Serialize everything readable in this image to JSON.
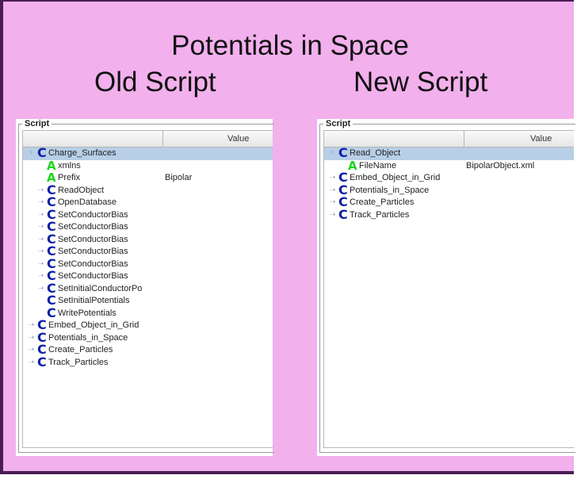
{
  "slide": {
    "title": "Potentials in Space",
    "left_heading": "Old Script",
    "right_heading": "New Script"
  },
  "left_panel": {
    "group_label": "Script",
    "value_header": "Value",
    "rows": [
      {
        "label": "Charge_Surfaces",
        "icon": "C",
        "handle": "expanded",
        "indent": 0,
        "selected": true,
        "value": ""
      },
      {
        "label": "xmlns",
        "icon": "A",
        "handle": "none",
        "indent": 1,
        "value": ""
      },
      {
        "label": "Prefix",
        "icon": "A",
        "handle": "none",
        "indent": 1,
        "value": "Bipolar"
      },
      {
        "label": "ReadObject",
        "icon": "C",
        "handle": "collapsed",
        "indent": 1,
        "value": ""
      },
      {
        "label": "OpenDatabase",
        "icon": "C",
        "handle": "collapsed",
        "indent": 1,
        "value": ""
      },
      {
        "label": "SetConductorBias",
        "icon": "C",
        "handle": "collapsed",
        "indent": 1,
        "value": ""
      },
      {
        "label": "SetConductorBias",
        "icon": "C",
        "handle": "collapsed",
        "indent": 1,
        "value": ""
      },
      {
        "label": "SetConductorBias",
        "icon": "C",
        "handle": "collapsed",
        "indent": 1,
        "value": ""
      },
      {
        "label": "SetConductorBias",
        "icon": "C",
        "handle": "collapsed",
        "indent": 1,
        "value": ""
      },
      {
        "label": "SetConductorBias",
        "icon": "C",
        "handle": "collapsed",
        "indent": 1,
        "value": ""
      },
      {
        "label": "SetConductorBias",
        "icon": "C",
        "handle": "collapsed",
        "indent": 1,
        "value": ""
      },
      {
        "label": "SetInitialConductorPo",
        "icon": "C",
        "handle": "collapsed",
        "indent": 1,
        "value": ""
      },
      {
        "label": "SetInitialPotentials",
        "icon": "C",
        "handle": "none",
        "indent": 1,
        "value": ""
      },
      {
        "label": "WritePotentials",
        "icon": "C",
        "handle": "none",
        "indent": 1,
        "value": ""
      },
      {
        "label": "Embed_Object_in_Grid",
        "icon": "C",
        "handle": "collapsed",
        "indent": 0,
        "value": ""
      },
      {
        "label": "Potentials_in_Space",
        "icon": "C",
        "handle": "collapsed",
        "indent": 0,
        "value": ""
      },
      {
        "label": "Create_Particles",
        "icon": "C",
        "handle": "collapsed",
        "indent": 0,
        "value": ""
      },
      {
        "label": "Track_Particles",
        "icon": "C",
        "handle": "collapsed",
        "indent": 0,
        "value": ""
      }
    ]
  },
  "right_panel": {
    "group_label": "Script",
    "value_header": "Value",
    "rows": [
      {
        "label": "Read_Object",
        "icon": "C",
        "handle": "expanded",
        "indent": 0,
        "selected": true,
        "value": ""
      },
      {
        "label": "FileName",
        "icon": "A",
        "handle": "none",
        "indent": 1,
        "value": "BipolarObject.xml"
      },
      {
        "label": "Embed_Object_in_Grid",
        "icon": "C",
        "handle": "collapsed",
        "indent": 0,
        "value": ""
      },
      {
        "label": "Potentials_in_Space",
        "icon": "C",
        "handle": "collapsed",
        "indent": 0,
        "value": ""
      },
      {
        "label": "Create_Particles",
        "icon": "C",
        "handle": "collapsed",
        "indent": 0,
        "value": ""
      },
      {
        "label": "Track_Particles",
        "icon": "C",
        "handle": "collapsed",
        "indent": 0,
        "value": ""
      }
    ]
  },
  "icons": {
    "expanded_handle": "handle-expanded-icon",
    "collapsed_handle": "handle-collapsed-icon",
    "class_icon": "class-c-icon",
    "attribute_icon": "attribute-a-icon"
  },
  "colors": {
    "slide_background": "#f2b0ec",
    "slide_border": "#4a1c55",
    "class_icon": "#0b1fa8",
    "attribute_icon": "#1fd61f",
    "selection": "#b8cfe7"
  }
}
